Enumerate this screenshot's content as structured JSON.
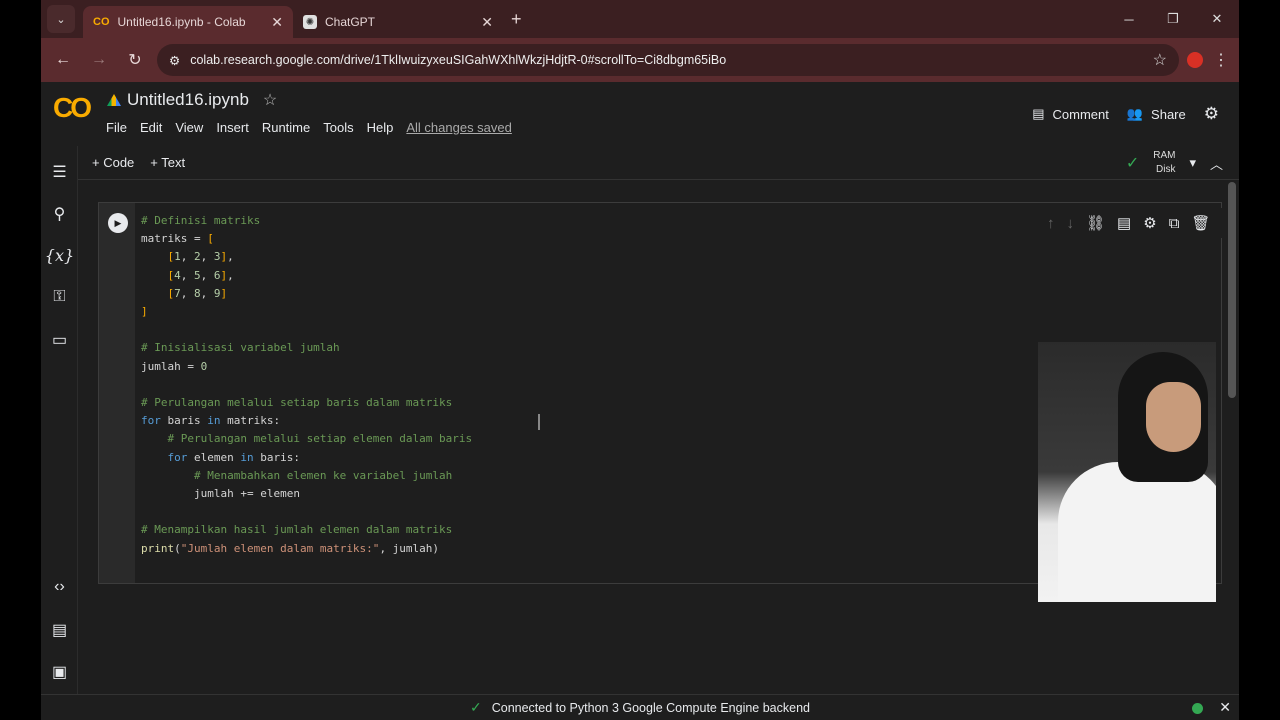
{
  "browser": {
    "tabs": [
      {
        "title": "Untitled16.ipynb - Colab",
        "icon": "colab-icon"
      },
      {
        "title": "ChatGPT",
        "icon": "chatgpt-icon"
      }
    ],
    "url": "colab.research.google.com/drive/1TklIwuizyxeuSIGahWXhlWkzjHdjtR-0#scrollTo=Ci8dbgm65iBo"
  },
  "colab": {
    "logo": "CO",
    "notebook_title": "Untitled16.ipynb",
    "menu": [
      "File",
      "Edit",
      "View",
      "Insert",
      "Runtime",
      "Tools",
      "Help"
    ],
    "save_status": "All changes saved",
    "comment_label": "Comment",
    "share_label": "Share",
    "add_code": "+ Code",
    "add_text": "+ Text",
    "ram_label": "RAM",
    "disk_label": "Disk",
    "status_message": "Connected to Python 3 Google Compute Engine backend"
  },
  "cell": {
    "code_lines": [
      "# Definisi matriks",
      "matriks = [",
      "    [1, 2, 3],",
      "    [4, 5, 6],",
      "    [7, 8, 9]",
      "]",
      "",
      "# Inisialisasi variabel jumlah",
      "jumlah = 0",
      "",
      "# Perulangan melalui setiap baris dalam matriks",
      "for baris in matriks:",
      "    # Perulangan melalui setiap elemen dalam baris",
      "    for elemen in baris:",
      "        # Menambahkan elemen ke variabel jumlah",
      "        jumlah += elemen",
      "",
      "# Menampilkan hasil jumlah elemen dalam matriks",
      "print(\"Jumlah elemen dalam matriks:\", jumlah)"
    ]
  },
  "colors": {
    "accent": "#f9ab00",
    "connected": "#34a853",
    "titlebar": "#3b1f21",
    "addressbar": "#5a2b2e"
  }
}
